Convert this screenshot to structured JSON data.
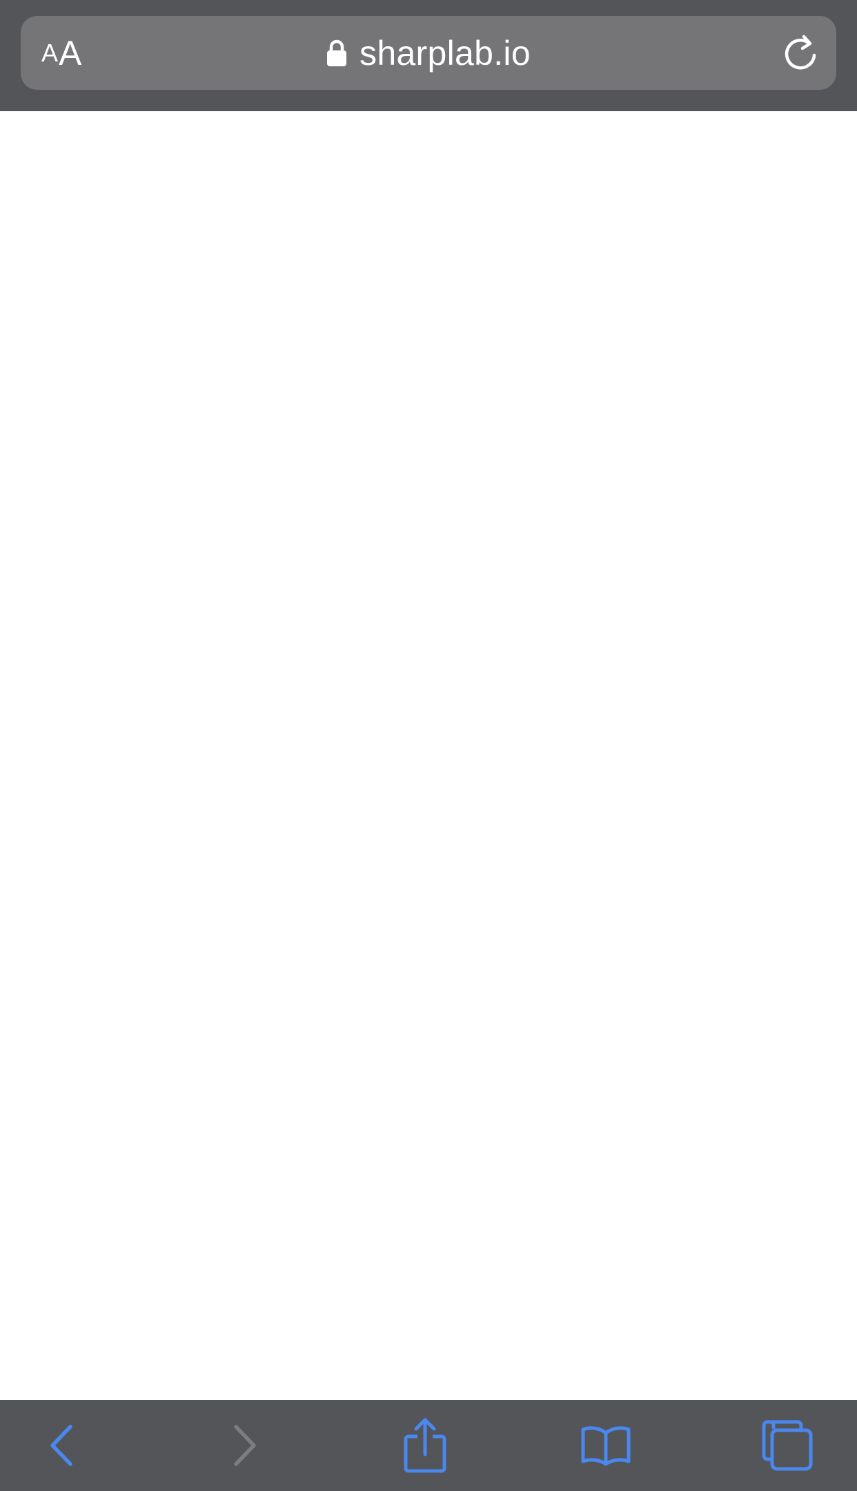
{
  "browser": {
    "reader_button": {
      "small": "A",
      "large": "A"
    },
    "address": {
      "url": "sharplab.io",
      "secure": true
    },
    "icons": {
      "lock": "lock-icon",
      "reload": "reload-icon",
      "back": "back-chevron-icon",
      "forward": "forward-chevron-icon",
      "share": "share-icon",
      "bookmarks": "book-icon",
      "tabs": "tabs-icon"
    },
    "toolbar": {
      "back_enabled": true,
      "forward_enabled": false
    },
    "colors": {
      "chrome_bg": "#545558",
      "address_bg": "#757577",
      "accent": "#4A88F0",
      "disabled": "#7C7D81"
    }
  }
}
